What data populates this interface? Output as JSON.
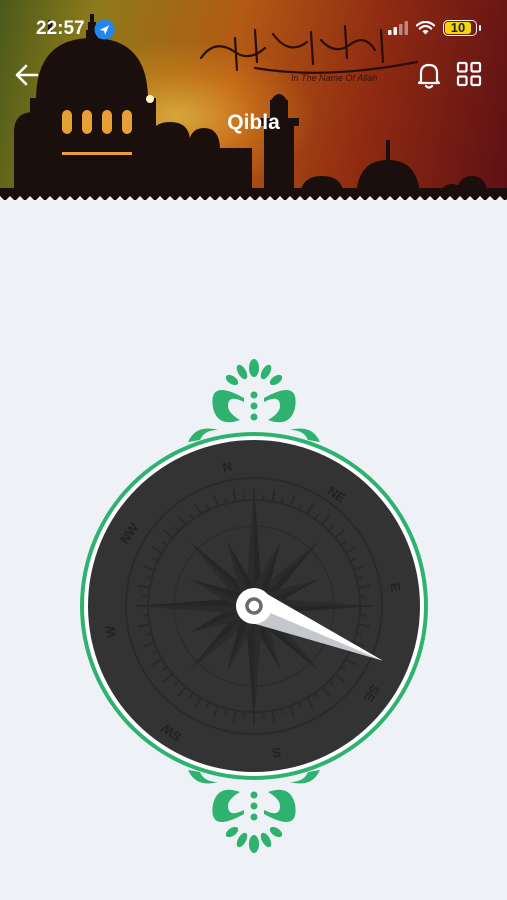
{
  "status_bar": {
    "time": "22:57",
    "battery": "10",
    "location_icon": "location-arrow-icon",
    "signal_icon": "cellular-signal-icon",
    "wifi_icon": "wifi-icon"
  },
  "header": {
    "title": "Qibla",
    "banner_caption": "In The Name Of Allah",
    "back_icon": "arrow-left-icon",
    "bell_icon": "bell-icon",
    "menu_icon": "grid-icon"
  },
  "compass": {
    "directions": {
      "n": "N",
      "ne": "NE",
      "e": "E",
      "se": "SE",
      "s": "S",
      "sw": "SW",
      "w": "W",
      "nw": "NW"
    },
    "needle_bearing_deg": 113,
    "accent_color": "#2fb26f",
    "dial_color": "#333333"
  }
}
